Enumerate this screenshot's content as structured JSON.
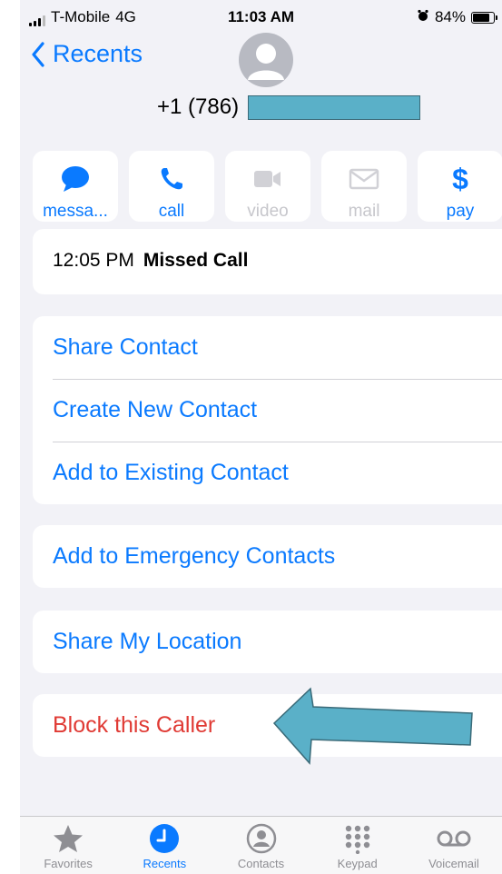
{
  "status": {
    "carrier": "T-Mobile",
    "network": "4G",
    "time": "11:03 AM",
    "battery_percent": "84%",
    "battery_level": 0.84
  },
  "nav": {
    "back_label": "Recents"
  },
  "contact": {
    "number": "+1 (786)"
  },
  "actions": [
    {
      "label": "messa...",
      "icon": "message-icon",
      "enabled": true
    },
    {
      "label": "call",
      "icon": "phone-icon",
      "enabled": true
    },
    {
      "label": "video",
      "icon": "video-icon",
      "enabled": false
    },
    {
      "label": "mail",
      "icon": "mail-icon",
      "enabled": false
    },
    {
      "label": "pay",
      "icon": "dollar-icon",
      "enabled": true
    }
  ],
  "call_log": {
    "time": "12:05 PM",
    "type": "Missed Call"
  },
  "options": {
    "share_contact": "Share Contact",
    "create_new_contact": "Create New Contact",
    "add_to_existing": "Add to Existing Contact",
    "add_to_emergency": "Add to Emergency Contacts",
    "share_location": "Share My Location",
    "block_caller": "Block this Caller"
  },
  "tabs": [
    {
      "label": "Favorites",
      "icon": "star-icon",
      "active": false
    },
    {
      "label": "Recents",
      "icon": "clock-icon",
      "active": true
    },
    {
      "label": "Contacts",
      "icon": "person-circle-icon",
      "active": false
    },
    {
      "label": "Keypad",
      "icon": "keypad-icon",
      "active": false
    },
    {
      "label": "Voicemail",
      "icon": "voicemail-icon",
      "active": false
    }
  ],
  "colors": {
    "accent": "#0a7aff",
    "destructive": "#e03a34",
    "annotation_arrow": "#5ab0c8",
    "background": "#f2f2f7"
  }
}
